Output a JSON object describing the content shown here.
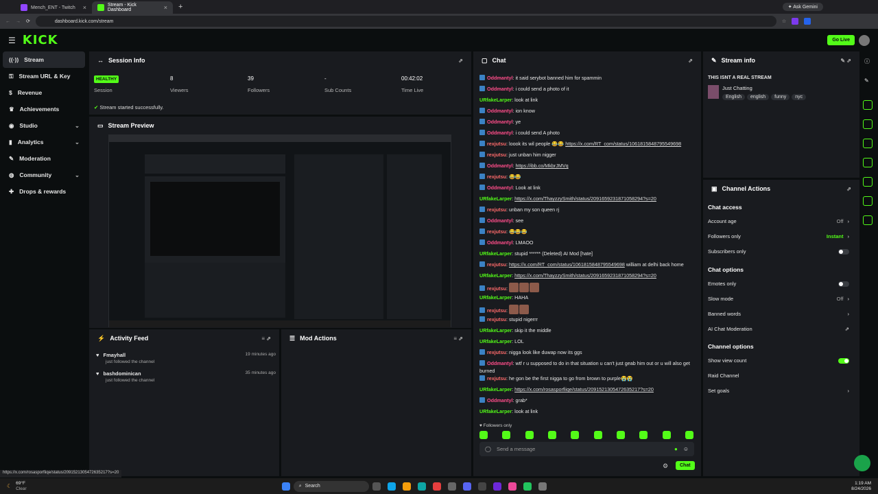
{
  "browser": {
    "tabs": [
      {
        "label": "Mench_ENT - Twitch",
        "active": false
      },
      {
        "label": "Stream - Kick Dashboard",
        "active": true
      }
    ],
    "url": "dashboard.kick.com/stream",
    "ask_gemini": "Ask Gemini"
  },
  "header": {
    "logo": "KICK",
    "go_live": "Go Live"
  },
  "sidebar": {
    "items": [
      {
        "label": "Stream",
        "icon": "broadcast-icon",
        "active": true
      },
      {
        "label": "Stream URL & Key",
        "icon": "key-icon"
      },
      {
        "label": "Revenue",
        "icon": "dollar-icon"
      },
      {
        "label": "Achievements",
        "icon": "trophy-icon"
      },
      {
        "label": "Studio",
        "icon": "studio-icon",
        "chevron": true
      },
      {
        "label": "Analytics",
        "icon": "chart-icon",
        "chevron": true
      },
      {
        "label": "Moderation",
        "icon": "wrench-icon"
      },
      {
        "label": "Community",
        "icon": "community-icon",
        "chevron": true
      },
      {
        "label": "Drops & rewards",
        "icon": "gift-icon"
      }
    ]
  },
  "session": {
    "title": "Session Info",
    "status": "HEALTHY",
    "status_label": "Session",
    "viewers": "8",
    "viewers_label": "Viewers",
    "followers": "39",
    "followers_label": "Followers",
    "subs": "-",
    "subs_label": "Sub Counts",
    "time": "00:42:02",
    "time_label": "Time Live",
    "started": "Stream started successfully."
  },
  "preview": {
    "title": "Stream Preview"
  },
  "activity": {
    "title": "Activity Feed",
    "items": [
      {
        "user": "Fmayhall",
        "text": "just followed the channel",
        "time": "19 minutes ago"
      },
      {
        "user": "bashdominican",
        "text": "just followed the channel",
        "time": "35 minutes ago"
      }
    ]
  },
  "mod": {
    "title": "Mod Actions"
  },
  "chat": {
    "title": "Chat",
    "messages": [
      {
        "user": "Oddmantyl",
        "c": "un1",
        "badge": true,
        "text": "it said serybot banned him for spammin"
      },
      {
        "user": "Oddmantyl",
        "c": "un1",
        "badge": true,
        "text": "i could send a photo of it"
      },
      {
        "user": "URfakeLarper",
        "c": "un3",
        "badge": false,
        "text": "look at link"
      },
      {
        "user": "Oddmantyl",
        "c": "un1",
        "badge": true,
        "text": "ion know"
      },
      {
        "user": "Oddmantyl",
        "c": "un1",
        "badge": true,
        "text": "ye"
      },
      {
        "user": "Oddmantyl",
        "c": "un1",
        "badge": true,
        "text": "i could send A photo"
      },
      {
        "user": "rexjutsu",
        "c": "un2",
        "badge": true,
        "text": "loook its wil people 😂😂",
        "link": "https://x.com/RT_com/status/1061815848795549698"
      },
      {
        "user": "rexjutsu",
        "c": "un2",
        "badge": true,
        "text": "just unban him nigger"
      },
      {
        "user": "Oddmantyl",
        "c": "un1",
        "badge": true,
        "link": "https://ibb.co/MkbrJMVq"
      },
      {
        "user": "rexjutsu",
        "c": "un2",
        "badge": true,
        "text": "😂😂"
      },
      {
        "user": "Oddmantyl",
        "c": "un1",
        "badge": true,
        "text": "Look at link"
      },
      {
        "user": "URfakeLarper",
        "c": "un3",
        "badge": false,
        "link": "https://x.com/ThayzzySmith/status/2091659231871058294?s=20"
      },
      {
        "user": "rexjutsu",
        "c": "un2",
        "badge": true,
        "text": "unban my son queen rj"
      },
      {
        "user": "Oddmantyl",
        "c": "un1",
        "badge": true,
        "text": "see"
      },
      {
        "user": "rexjutsu",
        "c": "un2",
        "badge": true,
        "text": "😂😂😂"
      },
      {
        "user": "Oddmantyl",
        "c": "un1",
        "badge": true,
        "text": "LMAOO"
      },
      {
        "user": "URfakeLarper",
        "c": "un3",
        "badge": false,
        "text": "stupid ****** (Deleted) AI Mod [hate]"
      },
      {
        "user": "rexjutsu",
        "c": "un2",
        "badge": true,
        "link": "https://x.com/RT_com/status/1061815848795549698",
        "text2": "william at delhi back home"
      },
      {
        "user": "URfakeLarper",
        "c": "un3",
        "badge": false,
        "link": "https://x.com/ThayzzySmith/status/2091659231871058294?s=20"
      },
      {
        "user": "rexjutsu",
        "c": "un2",
        "badge": true,
        "emotes": 3
      },
      {
        "user": "URfakeLarper",
        "c": "un3",
        "badge": false,
        "text": "HAHA"
      },
      {
        "user": "rexjutsu",
        "c": "un2",
        "badge": true,
        "emotes": 2
      },
      {
        "user": "rexjutsu",
        "c": "un2",
        "badge": true,
        "text": "stupid nigerrr"
      },
      {
        "user": "URfakeLarper",
        "c": "un3",
        "badge": false,
        "text": "skip it the middle"
      },
      {
        "user": "URfakeLarper",
        "c": "un3",
        "badge": false,
        "text": "LOL"
      },
      {
        "user": "rexjutsu",
        "c": "un2",
        "badge": true,
        "text": "nigga look like duwap now its ggs"
      },
      {
        "user": "Oddmantyl",
        "c": "un1",
        "badge": true,
        "text": "wtf r u supposed to do in that situation u can't just geab him out or u will also get burned"
      },
      {
        "user": "rexjutsu",
        "c": "un2",
        "badge": true,
        "text": "he gon be the first nigga to go from brown to purple😭😭"
      },
      {
        "user": "URfakeLarper",
        "c": "un3",
        "badge": false,
        "link": "https://x.com/rosasporfiiqe/status/2091521305472635217?s=20"
      },
      {
        "user": "Oddmantyl",
        "c": "un1",
        "badge": true,
        "text": "grab*"
      },
      {
        "user": "URfakeLarper",
        "c": "un3",
        "badge": false,
        "text": "look at link"
      }
    ],
    "followers_only": "Followers only",
    "placeholder": "Send a message",
    "send": "Chat"
  },
  "streaminfo": {
    "title": "Stream info",
    "stream_title": "THIS ISNT A REAL STREAM",
    "category": "Just Chatting",
    "tags": [
      "English",
      "english",
      "funny",
      "nyc"
    ]
  },
  "actions": {
    "title": "Channel Actions",
    "chat_access": "Chat access",
    "account_age": "Account age",
    "account_age_val": "Off",
    "followers_only": "Followers only",
    "followers_only_val": "Instant",
    "subs_only": "Subscribers only",
    "chat_options": "Chat options",
    "emotes_only": "Emotes only",
    "slow_mode": "Slow mode",
    "slow_mode_val": "Off",
    "banned_words": "Banned words",
    "ai_mod": "AI Chat Moderation",
    "channel_options": "Channel options",
    "show_view_count": "Show view count",
    "raid": "Raid Channel",
    "goals": "Set goals"
  },
  "status_url": "https://x.com/rosasporfiiqe/status/2091521305472635217?s=20",
  "taskbar": {
    "temp": "69°F",
    "weather": "Clear",
    "search": "Search",
    "time": "1:19 AM",
    "date": "8/24/2026"
  },
  "colors": {
    "accent": "#53fc18",
    "panel": "#191b1f",
    "bg": "#0b0e0f"
  }
}
